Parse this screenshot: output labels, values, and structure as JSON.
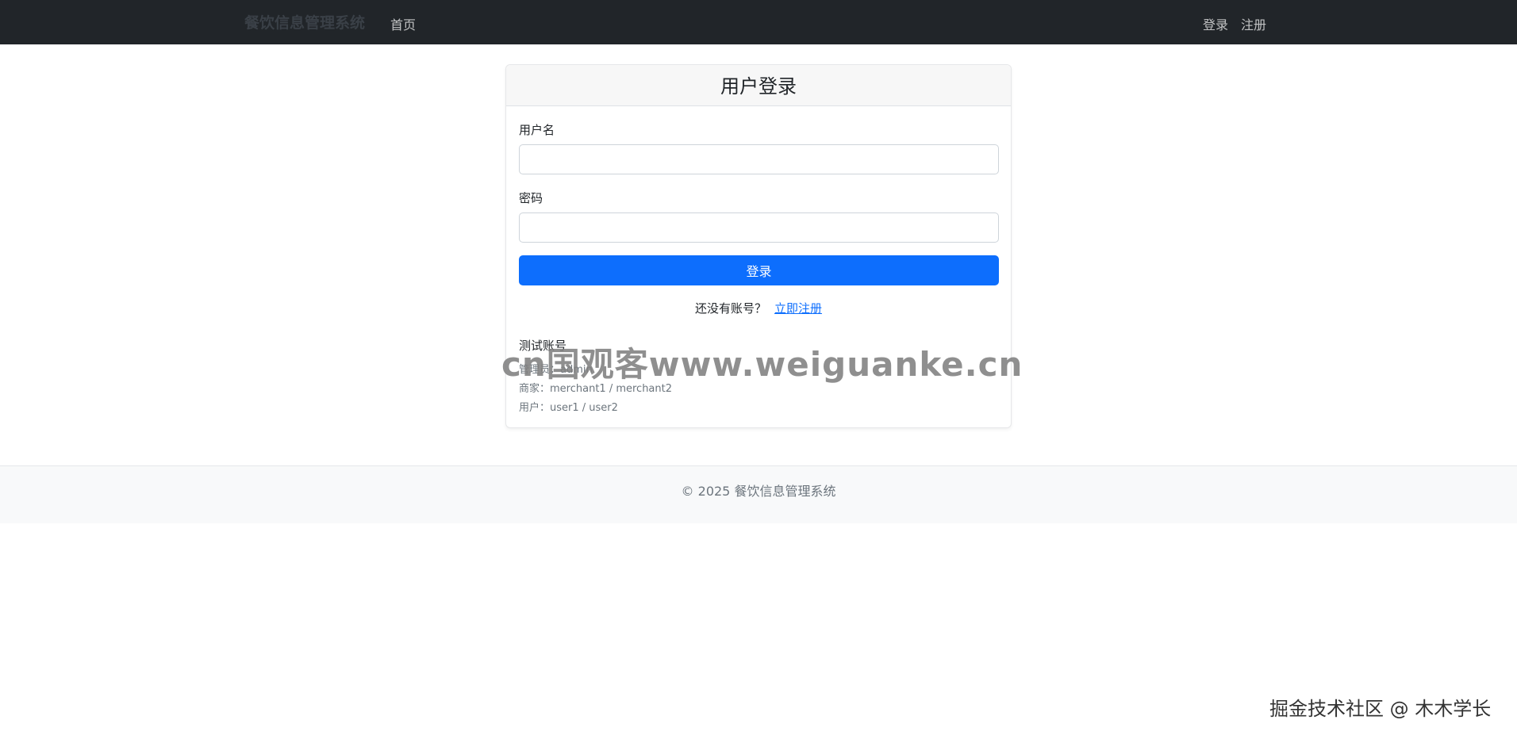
{
  "navbar": {
    "brand": "餐饮信息管理系统",
    "home_link": "首页",
    "login_link": "登录",
    "register_link": "注册"
  },
  "login_card": {
    "title": "用户登录",
    "username_label": "用户名",
    "username_value": "",
    "password_label": "密码",
    "password_value": "",
    "submit_label": "登录",
    "register_prompt": "还没有账号？",
    "register_link": "立即注册"
  },
  "test_accounts": {
    "title": "测试账号",
    "admin": "管理员：admin",
    "merchant": "商家：merchant1 / merchant2",
    "user": "用户：user1 / user2"
  },
  "footer": {
    "text": "© 2025 餐饮信息管理系统"
  },
  "watermarks": {
    "center": "cn国观客www.weiguanke.cn",
    "corner": "掘金技术社区 @ 木木学长"
  },
  "colors": {
    "navbar_bg": "#212529",
    "primary": "#0d6efd",
    "footer_bg": "#f8f9fa"
  }
}
